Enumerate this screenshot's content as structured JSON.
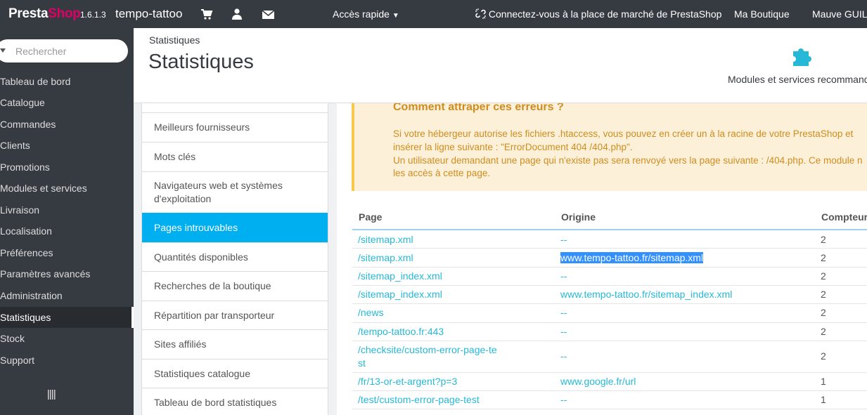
{
  "topbar": {
    "brand_presta": "Presta",
    "brand_shop": "Shop",
    "version": "1.6.1.3",
    "shop_name": "tempo-tattoo",
    "quick_access": "Accès rapide",
    "marketplace": "Connectez-vous à la place de marché de PrestaShop",
    "my_shop": "Ma Boutique",
    "user": "Mauve GUILLON",
    "icons": [
      "cart-icon",
      "user-icon",
      "envelope-icon",
      "caret-down-icon",
      "unlink-icon"
    ]
  },
  "sidebar": {
    "search_placeholder": "Rechercher",
    "items": [
      {
        "label": "Tableau de bord"
      },
      {
        "label": "Catalogue"
      },
      {
        "label": "Commandes"
      },
      {
        "label": "Clients"
      },
      {
        "label": "Promotions"
      },
      {
        "label": "Modules et services"
      },
      {
        "label": "Livraison"
      },
      {
        "label": "Localisation"
      },
      {
        "label": "Préférences"
      },
      {
        "label": "Paramètres avancés"
      },
      {
        "label": "Administration"
      },
      {
        "label": "Statistiques",
        "active": true
      },
      {
        "label": "Stock"
      },
      {
        "label": "Support"
      }
    ]
  },
  "header": {
    "breadcrumb": "Statistiques",
    "title": "Statistiques",
    "modules_label": "Modules et services recommandés",
    "modules_icon": "puzzle-icon"
  },
  "stats_list": {
    "items": [
      {
        "label": "Meilleurs fournisseurs"
      },
      {
        "label": "Mots clés"
      },
      {
        "label": "Navigateurs web et systèmes d'exploitation"
      },
      {
        "label": "Pages introuvables",
        "active": true
      },
      {
        "label": "Quantités disponibles"
      },
      {
        "label": "Recherches de la boutique"
      },
      {
        "label": "Répartition par transporteur"
      },
      {
        "label": "Sites affiliés"
      },
      {
        "label": "Statistiques catalogue"
      },
      {
        "label": "Tableau de bord statistiques"
      }
    ]
  },
  "alert": {
    "title": "Comment attraper ces erreurs ?",
    "line1": "Si votre hébergeur autorise les fichiers .htaccess, vous pouvez en créer un à la racine de votre PrestaShop et",
    "line2": "insérer la ligne suivante : \"ErrorDocument 404 /404.php\".",
    "line3": "Un utilisateur demandant une page qui n'existe pas sera renvoyé vers la page suivante : /404.php. Ce module n",
    "line4": "les accès à cette page."
  },
  "table": {
    "headers": {
      "page": "Page",
      "origin": "Origine",
      "counter": "Compteur"
    },
    "rows": [
      {
        "page": "/sitemap.xml",
        "origin": "--",
        "count": "2"
      },
      {
        "page": "/sitemap.xml",
        "origin": "www.tempo-tattoo.fr/sitemap.xml",
        "count": "2",
        "selected": true
      },
      {
        "page": "/sitemap_index.xml",
        "origin": "--",
        "count": "2"
      },
      {
        "page": "/sitemap_index.xml",
        "origin": "www.tempo-tattoo.fr/sitemap_index.xml",
        "count": "2"
      },
      {
        "page": "/news",
        "origin": "--",
        "count": "2"
      },
      {
        "page": "/tempo-tattoo.fr:443",
        "origin": "--",
        "count": "2"
      },
      {
        "page": "/checksite/custom-error-page-test",
        "origin": "--",
        "count": "2"
      },
      {
        "page": "/fr/13-or-et-argent?p=3",
        "origin": "www.google.fr/url",
        "count": "1"
      },
      {
        "page": "/test/custom-error-page-test",
        "origin": "--",
        "count": "1"
      }
    ]
  },
  "colors": {
    "topbar": "#363a41",
    "accent": "#00aff0",
    "link": "#25b9d7",
    "brand_pink": "#df0067",
    "warning_bg": "#fcf1d8",
    "warning_text": "#d08c1f"
  }
}
